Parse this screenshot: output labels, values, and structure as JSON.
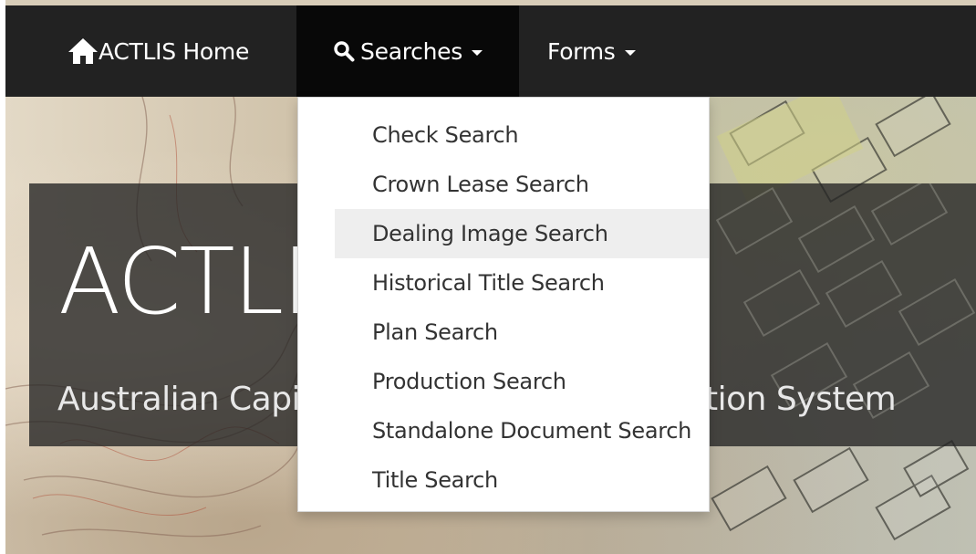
{
  "navbar": {
    "home": {
      "label": "ACTLIS Home",
      "icon": "home-icon"
    },
    "searches": {
      "label": "Searches",
      "icon": "search-icon"
    },
    "forms": {
      "label": "Forms"
    }
  },
  "hero": {
    "title": "ACTLIS",
    "subtitle": "Australian Capital Territory Land Information System"
  },
  "dropdown": {
    "items": [
      {
        "label": "Check Search"
      },
      {
        "label": "Crown Lease Search"
      },
      {
        "label": "Dealing Image Search",
        "highlighted": true
      },
      {
        "label": "Historical Title Search"
      },
      {
        "label": "Plan Search"
      },
      {
        "label": "Production Search"
      },
      {
        "label": "Standalone Document Search"
      },
      {
        "label": "Title Search"
      }
    ]
  },
  "colors": {
    "navbar_bg": "#222222",
    "navbar_active_bg": "#080808",
    "dropdown_hover_bg": "#eeeeee",
    "hero_band": "#232323"
  }
}
